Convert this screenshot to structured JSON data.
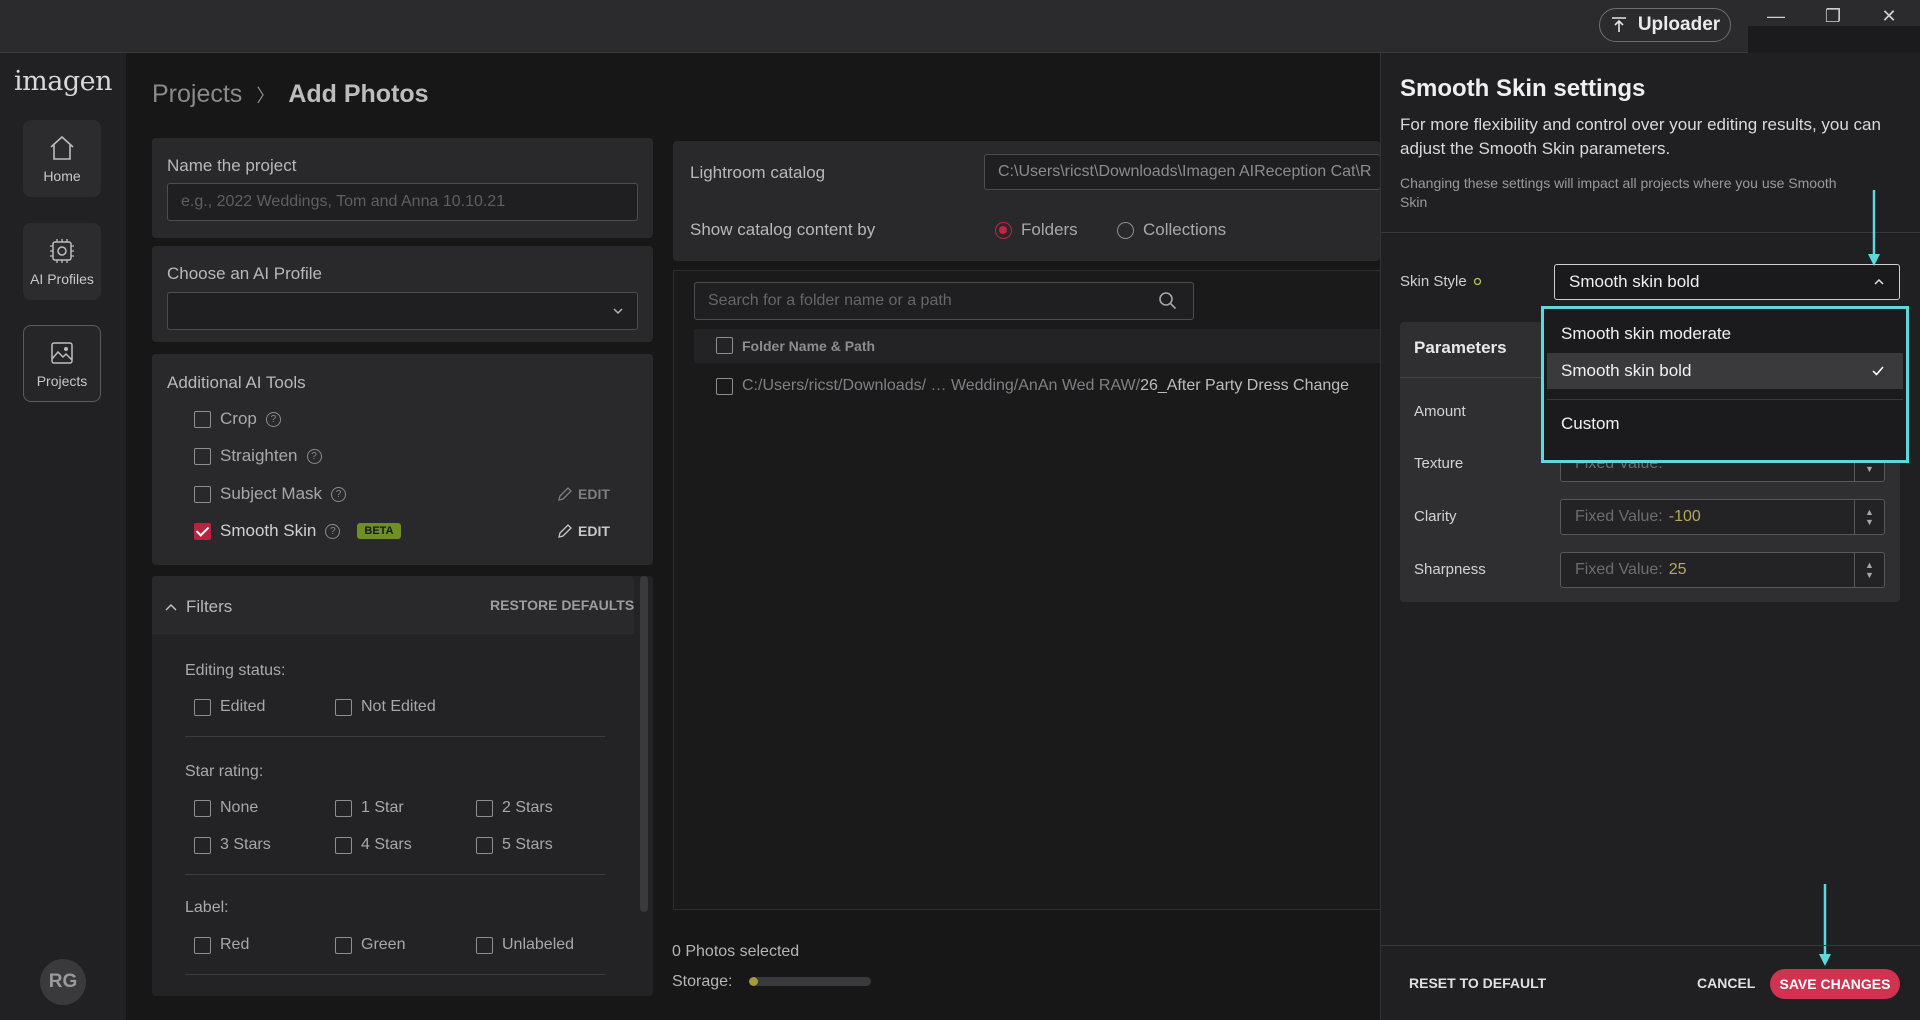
{
  "titlebar": {
    "uploader_label": "Uploader",
    "minimize_glyph": "—",
    "restore_glyph": "❐",
    "close_glyph": "✕"
  },
  "nav": {
    "logo": "imagen",
    "items": [
      {
        "label": "Home",
        "icon": "home-icon"
      },
      {
        "label": "AI Profiles",
        "icon": "ai-profiles-icon"
      },
      {
        "label": "Projects",
        "icon": "projects-icon"
      }
    ],
    "avatar_initials": "RG"
  },
  "breadcrumb": {
    "parent": "Projects",
    "separator": "〉",
    "current": "Add Photos"
  },
  "project": {
    "name_label": "Name the project",
    "name_placeholder": "e.g., 2022 Weddings, Tom and Anna 10.10.21",
    "profile_label": "Choose an AI Profile",
    "profile_value": ""
  },
  "ai_tools": {
    "title": "Additional AI Tools",
    "tools": [
      {
        "label": "Crop",
        "checked": false
      },
      {
        "label": "Straighten",
        "checked": false
      },
      {
        "label": "Subject Mask",
        "checked": false,
        "edit": "EDIT"
      },
      {
        "label": "Smooth Skin",
        "checked": true,
        "badge": "BETA",
        "edit": "EDIT"
      }
    ]
  },
  "filters": {
    "title": "Filters",
    "restore": "RESTORE DEFAULTS",
    "editing_status": {
      "label": "Editing status:",
      "options": [
        "Edited",
        "Not Edited"
      ]
    },
    "star_rating": {
      "label": "Star rating:",
      "options": [
        "None",
        "1 Star",
        "2 Stars",
        "3 Stars",
        "4 Stars",
        "5 Stars"
      ]
    },
    "label": {
      "label": "Label:",
      "options": [
        "Red",
        "Green",
        "Unlabeled"
      ]
    }
  },
  "catalog": {
    "lightroom_label": "Lightroom catalog",
    "lightroom_path": "C:\\Users\\ricst\\Downloads\\Imagen AIReception Cat\\R",
    "show_by_label": "Show catalog content by",
    "folders": "Folders",
    "collections": "Collections",
    "search_placeholder": "Search for a folder name or a path",
    "column_header": "Folder Name & Path",
    "rows": [
      {
        "path_dim": "C:/Users/ricst/Downloads/  … Wedding/AnAn Wed RAW/",
        "path_bright": "26_After Party Dress Change"
      }
    ]
  },
  "status": {
    "photos_selected": "0 Photos selected",
    "storage_label": "Storage:",
    "storage_fraction": 0.04
  },
  "smooth_skin": {
    "title": "Smooth Skin settings",
    "description": "For more flexibility and control over your editing results, you can adjust the Smooth Skin parameters.",
    "note": "Changing these settings will impact all projects where you use Smooth Skin",
    "skin_style_label": "Skin Style",
    "skin_style_value": "Smooth skin bold",
    "parameters_title": "Parameters",
    "params": [
      {
        "label": "Amount",
        "prefix": "",
        "value": ""
      },
      {
        "label": "Texture",
        "prefix": "Fixed Value:",
        "value": ""
      },
      {
        "label": "Clarity",
        "prefix": "Fixed Value:",
        "value": "-100"
      },
      {
        "label": "Sharpness",
        "prefix": "Fixed Value:",
        "value": "25"
      }
    ],
    "dropdown_options": [
      {
        "label": "Smooth skin moderate",
        "selected": false
      },
      {
        "label": "Smooth skin bold",
        "selected": true
      },
      {
        "label": "Custom",
        "selected": false
      }
    ],
    "reset": "RESET TO DEFAULT",
    "cancel": "CANCEL",
    "save": "SAVE CHANGES"
  },
  "colors": {
    "accent": "#d0324f",
    "highlight": "#5fd8dc",
    "value_text": "#b7a85a"
  }
}
